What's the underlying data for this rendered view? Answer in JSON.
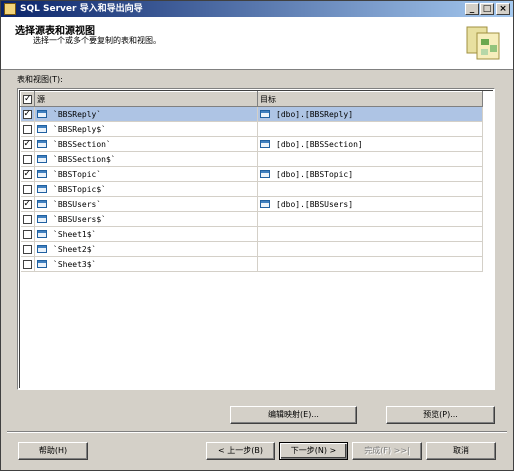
{
  "window": {
    "title": "SQL Server 导入和导出向导",
    "minimize": "_",
    "maximize": "□",
    "close": "×"
  },
  "header": {
    "title": "选择源表和源视图",
    "subtitle": "选择一个或多个要复制的表和视图。"
  },
  "list_label": "表和视图(T):",
  "columns": {
    "source": "源",
    "destination": "目标"
  },
  "rows": [
    {
      "checked": true,
      "source": "`BBSReply`",
      "destination": "[dbo].[BBSReply]",
      "selected": true
    },
    {
      "checked": false,
      "source": "`BBSReply$`",
      "destination": ""
    },
    {
      "checked": true,
      "source": "`BBSSection`",
      "destination": "[dbo].[BBSSection]"
    },
    {
      "checked": false,
      "source": "`BBSSection$`",
      "destination": ""
    },
    {
      "checked": true,
      "source": "`BBSTopic`",
      "destination": "[dbo].[BBSTopic]"
    },
    {
      "checked": false,
      "source": "`BBSTopic$`",
      "destination": ""
    },
    {
      "checked": true,
      "source": "`BBSUsers`",
      "destination": "[dbo].[BBSUsers]"
    },
    {
      "checked": false,
      "source": "`BBSUsers$`",
      "destination": ""
    },
    {
      "checked": false,
      "source": "`Sheet1$`",
      "destination": ""
    },
    {
      "checked": false,
      "source": "`Sheet2$`",
      "destination": ""
    },
    {
      "checked": false,
      "source": "`Sheet3$`",
      "destination": ""
    }
  ],
  "buttons": {
    "edit_mappings": "编辑映射(E)...",
    "preview": "预览(P)...",
    "help": "帮助(H)",
    "back": "< 上一步(B)",
    "next": "下一步(N) >",
    "finish": "完成(F) >>|",
    "cancel": "取消"
  },
  "colors": {
    "title_gradient_start": "#0a246a",
    "title_gradient_end": "#a6caf0",
    "selection": "#aec4e4",
    "face": "#d4d0c8"
  }
}
